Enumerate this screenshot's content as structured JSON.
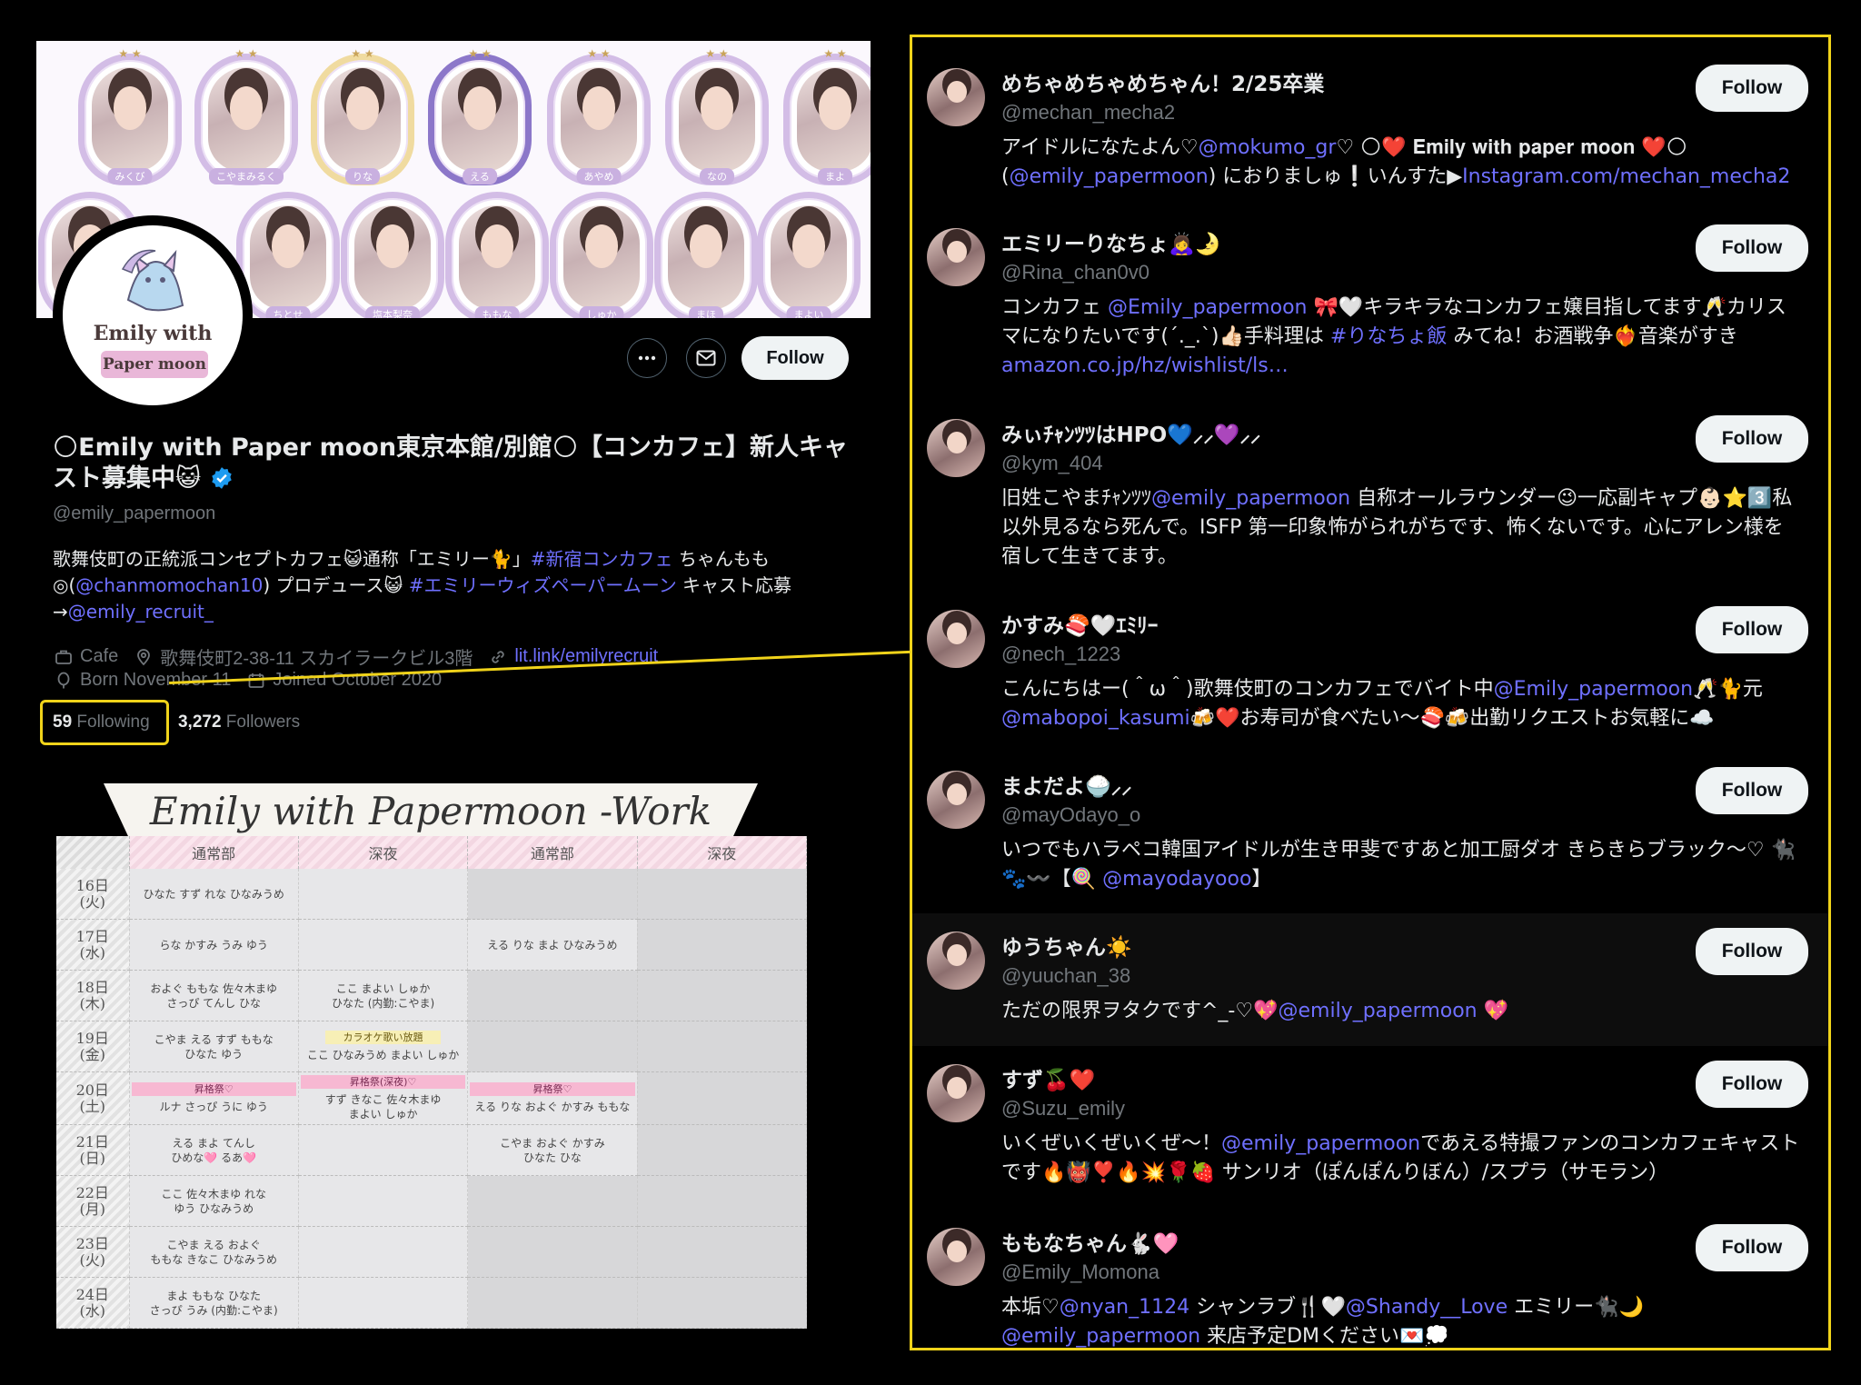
{
  "banner": {
    "row1": [
      "みくび",
      "こやまみるく",
      "りな",
      "える",
      "あやめ",
      "なの",
      "まよ"
    ],
    "row2": [
      "ちとせ",
      "塩本梨奈",
      "ももな",
      "しゅか",
      "まほ",
      "まよい"
    ]
  },
  "logo": {
    "line1": "Emily with",
    "line2": "Paper moon"
  },
  "profile": {
    "follow_label": "Follow",
    "name": "🌕Emily with Paper moon東京本館/別館🌕【コンカフェ】新人キャスト募集中😺",
    "handle": "@emily_papermoon",
    "bio": {
      "t1": "歌舞伎町の正統派コンセプトカフェ😺通称「エミリー🐈」",
      "l1": "#新宿コンカフェ",
      "t2": " ちゃんもも◎(",
      "l2": "@chanmomochan10",
      "t3": ") プロデュース😺 ",
      "l3": "#エミリーウィズペーパームーン",
      "t4": " キャスト応募→",
      "l4": "@emily_recruit_"
    },
    "category": "Cafe",
    "location": "歌舞伎町2-38-11 スカイラークビル3階",
    "website": "lit.link/emilyrecruit",
    "born": "Born November 11",
    "joined": "Joined October 2020",
    "following_count": "59",
    "following_label": "Following",
    "followers_count": "3,272",
    "followers_label": "Followers"
  },
  "shift": {
    "title": "Emily with Papermoon -Work Shift-",
    "headers": [
      "通常部",
      "深夜",
      "通常部",
      "深夜"
    ],
    "rows": [
      {
        "date": "16日",
        "dow": "(火)",
        "c1": "ひなた すず れな ひなみうめ",
        "c2": "",
        "c3": "",
        "c4": ""
      },
      {
        "date": "17日",
        "dow": "(水)",
        "c1": "らな かすみ うみ ゆう",
        "c2": "",
        "c3": "える りな まよ ひなみうめ",
        "c4": ""
      },
      {
        "date": "18日",
        "dow": "(木)",
        "c1": "およぐ ももな 佐々木まゆ\nさっぴ てんし ひな",
        "c2": "ここ まよい しゅか\nひなた (内勤:こやま)",
        "c3": "",
        "c4": ""
      },
      {
        "date": "19日",
        "dow": "(金)",
        "c1": "こやま える すず ももな\nひなた ゆう",
        "c2tag": "カラオケ歌い放題",
        "c2": "ここ ひなみうめ まよい しゅか",
        "c3": "",
        "c4": ""
      },
      {
        "date": "20日",
        "dow": "(土)",
        "c1tag": "昇格祭♡",
        "c1": "ルナ さっぴ うに ゆう",
        "c2tag": "昇格祭(深夜)♡",
        "c2": "すず きなこ 佐々木まゆ\nまよい しゅか",
        "c3tag": "昇格祭♡",
        "c3": "える りな およぐ かすみ ももな",
        "c4": ""
      },
      {
        "date": "21日",
        "dow": "(日)",
        "c1": "える まよ てんし\nひめな🩷 るあ🩷",
        "c2": "",
        "c3": "こやま およぐ かすみ\nひなた ひな",
        "c4": ""
      },
      {
        "date": "22日",
        "dow": "(月)",
        "c1": "ここ 佐々木まゆ れな\nゆう ひなみうめ",
        "c2": "",
        "c3": "",
        "c4": ""
      },
      {
        "date": "23日",
        "dow": "(火)",
        "c1": "こやま える およぐ\nももな きなこ ひなみうめ",
        "c2": "",
        "c3": "",
        "c4": ""
      },
      {
        "date": "24日",
        "dow": "(水)",
        "c1": "まよ ももな ひなた\nさっぴ うみ (内勤:こやま)",
        "c2": "",
        "c3": "",
        "c4": ""
      }
    ]
  },
  "following": [
    {
      "name": "めちゃめちゃめちゃん！2/25卒業",
      "handle": "@mechan_mecha2",
      "bio": [
        {
          "t": "アイドルになたよん♡"
        },
        {
          "l": "@mokumo_gr"
        },
        {
          "t": "♡ 🌕❤️ 𝐄𝐦𝐢𝐥𝐲 𝐰𝐢𝐭𝐡 𝐩𝐚𝐩𝐞𝐫 𝐦𝐨𝐨𝐧 ❤️🌕 ("
        },
        {
          "l": "@emily_papermoon"
        },
        {
          "t": ") におりましゅ❕いんすた▶"
        },
        {
          "l": "Instagram.com/mechan_mecha2"
        }
      ]
    },
    {
      "name": "エミリーりなちょ🙇‍♀️🌛",
      "handle": "@Rina_chan0v0",
      "bio": [
        {
          "t": "コンカフェ "
        },
        {
          "l": "@Emily_papermoon"
        },
        {
          "t": " 🎀🤍キラキラなコンカフェ嬢目指してます🥂カリスマになりたいです(´._.`)👍🏻手料理は "
        },
        {
          "l": "#りなちょ飯"
        },
        {
          "t": " みてね！お酒戦争❤️‍🔥音楽がすき"
        },
        {
          "l": "amazon.co.jp/hz/wishlist/ls…"
        }
      ]
    },
    {
      "name": "みぃﾁｬﾝﾂﾂはHPO💙⸝⸝💜⸝⸝",
      "handle": "@kym_404",
      "bio": [
        {
          "t": "旧姓こやまﾁｬﾝﾂﾂ"
        },
        {
          "l": "@emily_papermoon"
        },
        {
          "t": " 自称オールラウンダー😉一応副キャプ👶🏻⭐️3️⃣私以外見るなら死んで。ISFP 第一印象怖がられがちです、怖くないです。心にアレン様を宿して生きてます。"
        }
      ]
    },
    {
      "name": "かすみ🍣🤍ｴﾐﾘｰ",
      "handle": "@nech_1223",
      "bio": [
        {
          "t": "こんにちはー(＾ω＾)歌舞伎町のコンカフェでバイト中"
        },
        {
          "l": "@Emily_papermoon"
        },
        {
          "t": "🥂🐈元"
        },
        {
          "l": "@mabopoi_kasumi"
        },
        {
          "t": "🍻❤️お寿司が食べたい〜🍣🍻出勤リクエストお気軽に☁️"
        }
      ]
    },
    {
      "name": "まよだよ🍚⸝⸝",
      "handle": "@mayOdayo_o",
      "bio": [
        {
          "t": "いつでもハラペコ韓国アイドルが生き甲斐ですあと加工厨ダオ きらきらブラック〜♡ 🐈‍⬛🐾〰️【🍭 "
        },
        {
          "l": "@mayodayooo"
        },
        {
          "t": "】"
        }
      ]
    },
    {
      "name": "ゆうちゃん☀️",
      "handle": "@yuuchan_38",
      "bio": [
        {
          "t": "ただの限界ヲタクです^_-♡💖"
        },
        {
          "l": "@emily_papermoon"
        },
        {
          "t": " 💖"
        }
      ]
    },
    {
      "name": "すず🍒❤️",
      "handle": "@Suzu_emily",
      "bio": [
        {
          "t": "いくぜいくぜいくぜ〜！"
        },
        {
          "l": "@emily_papermoon"
        },
        {
          "t": "であえる特撮ファンのコンカフェキャストです🔥👹❣️🔥💥🌹🍓 サンリオ（ぽんぽんりぼん）/スプラ（サモラン）"
        }
      ]
    },
    {
      "name": "ももなちゃん🐇🩷",
      "handle": "@Emily_Momona",
      "bio": [
        {
          "t": "本垢♡"
        },
        {
          "l": "@nyan_1124"
        },
        {
          "t": " シャンラブ🍴🤍"
        },
        {
          "l": "@Shandy__Love"
        },
        {
          "t": " エミリー🐈‍⬛🌙 "
        },
        {
          "l": "@emily_papermoon"
        },
        {
          "t": " 来店予定DMください💌💭"
        }
      ]
    }
  ],
  "following_follow_label": "Follow"
}
